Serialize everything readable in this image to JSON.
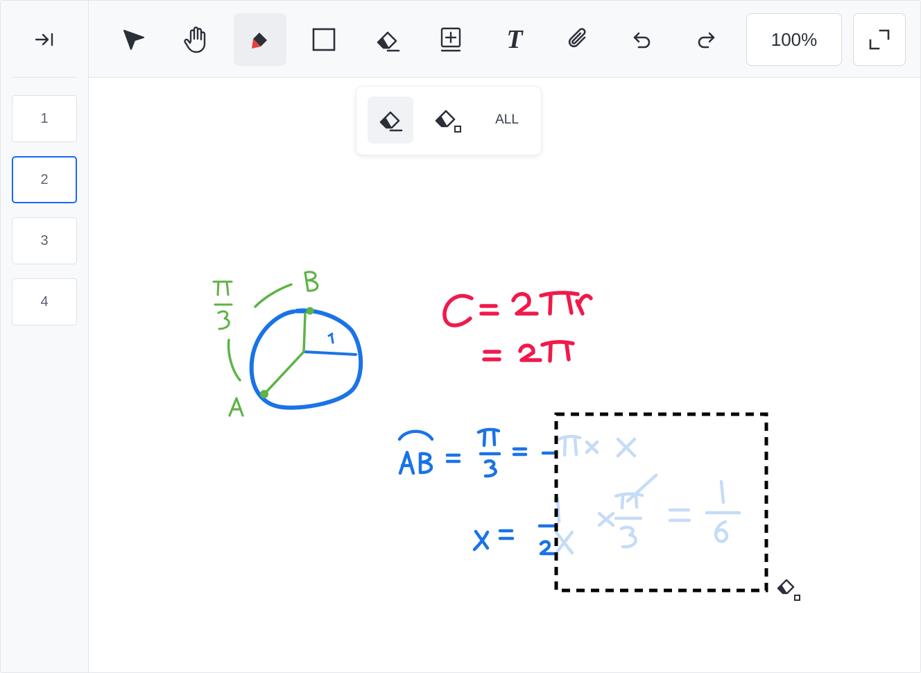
{
  "sidebar": {
    "collapse_icon": "collapse-sidebar-icon",
    "pages": [
      {
        "label": "1",
        "active": false
      },
      {
        "label": "2",
        "active": true
      },
      {
        "label": "3",
        "active": false
      },
      {
        "label": "4",
        "active": false
      }
    ]
  },
  "toolbar": {
    "tools": [
      {
        "name": "select",
        "icon": "pointer-arrow-icon"
      },
      {
        "name": "hand",
        "icon": "hand-icon"
      },
      {
        "name": "pen",
        "icon": "pen-icon",
        "active": true,
        "color": "#e8413c"
      },
      {
        "name": "rectangle",
        "icon": "rectangle-icon"
      },
      {
        "name": "eraser",
        "icon": "eraser-icon"
      },
      {
        "name": "add-box",
        "icon": "add-box-icon"
      },
      {
        "name": "text",
        "icon": "text-icon",
        "glyph": "T"
      },
      {
        "name": "attach",
        "icon": "paperclip-icon"
      },
      {
        "name": "undo",
        "icon": "undo-icon"
      },
      {
        "name": "redo",
        "icon": "redo-icon"
      }
    ],
    "zoom": "100%",
    "fullscreen_icon": "fullscreen-icon"
  },
  "eraser_popover": {
    "options": [
      "stroke-eraser",
      "area-eraser"
    ],
    "all_label": "ALL"
  },
  "canvas": {
    "colors": {
      "green": "#5db347",
      "blue": "#1a73e8",
      "red": "#f0194b",
      "faded_blue": "#c5dcf7",
      "selection": "#000000"
    },
    "circle_labels": {
      "arc_label": "π/3",
      "point_a": "A",
      "point_b": "B",
      "radius": "1"
    },
    "formula_red": [
      "C=2πr",
      "=2π"
    ],
    "formula_blue": [
      "AB = π/3 = 2π × x",
      "x = 1/2π × π/3 = 1/6"
    ]
  }
}
